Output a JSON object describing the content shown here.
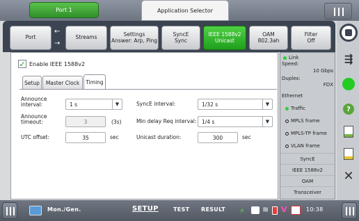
{
  "topbar": {
    "port_tab": "Port 1",
    "app_selector": "Application Selector"
  },
  "tabs": [
    {
      "label": "Port"
    },
    {
      "label": "Streams"
    },
    {
      "label": "Settings\nAnswer: Arp, Ping"
    },
    {
      "label": "SyncE\nSync"
    },
    {
      "label": "IEEE 1588v2\nUnicast"
    },
    {
      "label": "OAM\n802.3ah"
    },
    {
      "label": "Filter\nOff"
    }
  ],
  "main": {
    "enable_label": "Enable IEEE 1588v2",
    "subtabs": [
      "Setup",
      "Master Clock",
      "Timing"
    ],
    "announce_interval": {
      "label": "Announce\ninterval:",
      "value": "1 s"
    },
    "announce_timeout": {
      "label": "Announce\ntimeout:",
      "value": "3",
      "unit": "(3s)"
    },
    "utc_offset": {
      "label": "UTC offset:",
      "value": "35",
      "unit": "sec"
    },
    "synce_interval": {
      "label": "SyncE interval:",
      "value": "1/32 s"
    },
    "min_delay": {
      "label": "Min delay Req interval:",
      "value": "1/4 s"
    },
    "unicast_duration": {
      "label": "Unicast duration:",
      "value": "300",
      "unit": "sec"
    }
  },
  "status": {
    "link": "Link",
    "speed_label": "Speed:",
    "speed_value": "10 Gbps",
    "duplex_label": "Duplex:",
    "duplex_value": "FDX",
    "ethernet": "Ethernet",
    "items": [
      "Traffic",
      "MPLS frame",
      "MPLS-TP frame",
      "VLAN frame"
    ],
    "rows": [
      "SyncE",
      "IEEE 1588v2",
      "OAM",
      "Transceiver"
    ]
  },
  "bottombar": {
    "mon_gen": "Mon./Gen.",
    "setup": "SETUP",
    "test": "TEST",
    "result": "RESULT",
    "time": "10:38"
  },
  "colors": {
    "accent_green": "#2f9f28",
    "tab_dark": "#3b4450"
  }
}
